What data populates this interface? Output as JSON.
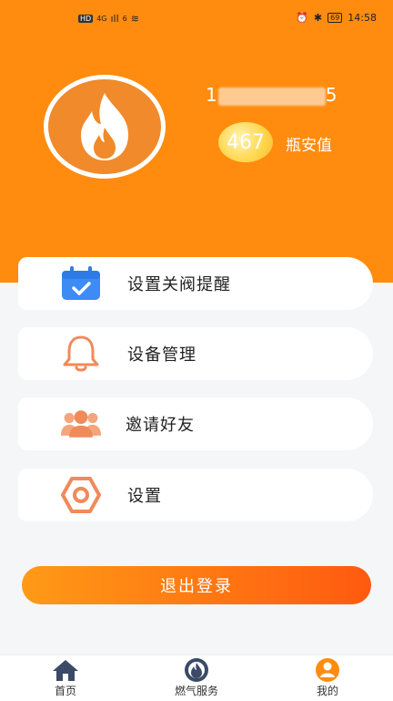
{
  "status_bar": {
    "left_badges": [
      "HD",
      "4G",
      "ıll",
      "6",
      "≋"
    ],
    "time": "14:58",
    "battery": "69"
  },
  "profile": {
    "phone_start": "1",
    "phone_end": "5",
    "score": "467",
    "score_label": "瓶安值"
  },
  "menu": [
    {
      "label": "设置关阀提醒",
      "icon": "calendar-check-icon"
    },
    {
      "label": "设备管理",
      "icon": "bell-icon"
    },
    {
      "label": "邀请好友",
      "icon": "users-icon"
    },
    {
      "label": "设置",
      "icon": "hexagon-settings-icon"
    }
  ],
  "logout_label": "退出登录",
  "tabs": [
    {
      "label": "首页",
      "icon": "home-icon"
    },
    {
      "label": "燃气服务",
      "icon": "flame-circle-icon"
    },
    {
      "label": "我的",
      "icon": "user-circle-icon"
    }
  ],
  "colors": {
    "brand": "#ff8c0f",
    "icon_orange": "#f08a5a",
    "icon_blue": "#3d8bf5"
  }
}
